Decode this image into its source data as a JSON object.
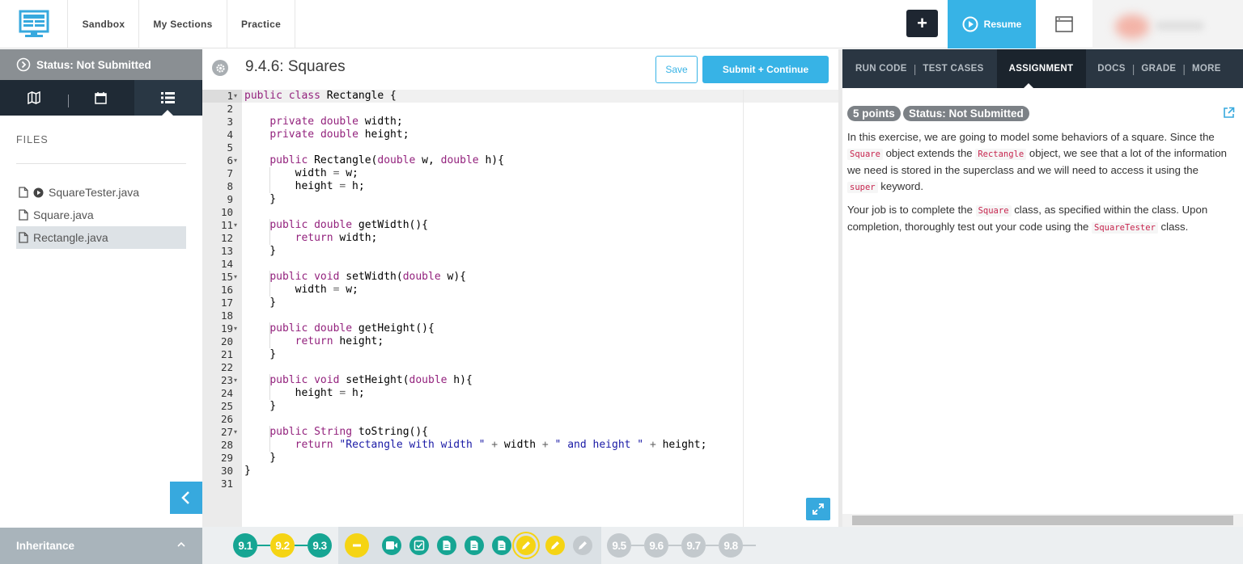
{
  "topnav": {
    "items": [
      "Sandbox",
      "My Sections",
      "Practice"
    ],
    "plus_label": "+",
    "resume_label": "Resume"
  },
  "left": {
    "status": "Status: Not Submitted",
    "files_heading": "FILES",
    "files": [
      {
        "name": "SquareTester.java",
        "runnable": true,
        "active": false
      },
      {
        "name": "Square.java",
        "runnable": false,
        "active": false
      },
      {
        "name": "Rectangle.java",
        "runnable": false,
        "active": true
      }
    ],
    "module": "Inheritance"
  },
  "editor": {
    "title": "9.4.6: Squares",
    "save_label": "Save",
    "submit_label": "Submit + Continue",
    "lines": [
      "public class Rectangle {",
      "",
      "    private double width;",
      "    private double height;",
      "",
      "    public Rectangle(double w, double h){",
      "        width = w;",
      "        height = h;",
      "    }",
      "",
      "    public double getWidth(){",
      "        return width;",
      "    }",
      "",
      "    public void setWidth(double w){",
      "        width = w;",
      "    }",
      "",
      "    public double getHeight(){",
      "        return height;",
      "    }",
      "",
      "    public void setHeight(double h){",
      "        height = h;",
      "    }",
      "",
      "    public String toString(){",
      "        return \"Rectangle with width \" + width + \" and height \" + height;",
      "    }",
      "}",
      ""
    ],
    "fold_lines": [
      1,
      6,
      11,
      15,
      19,
      23,
      27
    ]
  },
  "right": {
    "tabs": [
      "RUN CODE",
      "TEST CASES",
      "ASSIGNMENT",
      "DOCS",
      "GRADE",
      "MORE"
    ],
    "active_tab": "ASSIGNMENT",
    "points": "5 points",
    "status": "Status: Not Submitted",
    "p1": [
      {
        "t": "In this exercise, we are going to model some behaviors of a square. Since the "
      },
      {
        "c": "Square"
      },
      {
        "t": " object extends the "
      },
      {
        "c": "Rectangle"
      },
      {
        "t": " object, we see that a lot of the information we need is stored in the superclass and we will need to access it using the "
      },
      {
        "c": "super"
      },
      {
        "t": " keyword."
      }
    ],
    "p2": [
      {
        "t": "Your job is to complete the "
      },
      {
        "c": "Square"
      },
      {
        "t": " class, as specified within the class. Upon completion, thoroughly test out your code using the "
      },
      {
        "c": "SquareTester"
      },
      {
        "t": " class."
      }
    ]
  },
  "progress": {
    "nodes": [
      {
        "label": "9.1",
        "kind": "done"
      },
      {
        "label": "9.2",
        "kind": "partial"
      },
      {
        "label": "9.3",
        "kind": "done"
      },
      {
        "label": "",
        "kind": "minus-icon"
      },
      {
        "label": "",
        "kind": "video-icon"
      },
      {
        "label": "",
        "kind": "quiz-icon"
      },
      {
        "label": "",
        "kind": "doc-icon"
      },
      {
        "label": "",
        "kind": "doc-icon"
      },
      {
        "label": "",
        "kind": "doc-icon"
      },
      {
        "label": "",
        "kind": "pencil-icon"
      },
      {
        "label": "",
        "kind": "pencil-icon"
      },
      {
        "label": "",
        "kind": "pencil-icon"
      },
      {
        "label": "9.5",
        "kind": "todo"
      },
      {
        "label": "9.6",
        "kind": "todo"
      },
      {
        "label": "9.7",
        "kind": "todo"
      },
      {
        "label": "9.8",
        "kind": "todo"
      }
    ]
  },
  "colors": {
    "teal": "#16a593",
    "yellow": "#f5d414",
    "gray": "#c3c9cd",
    "accent": "#37b3e6"
  }
}
